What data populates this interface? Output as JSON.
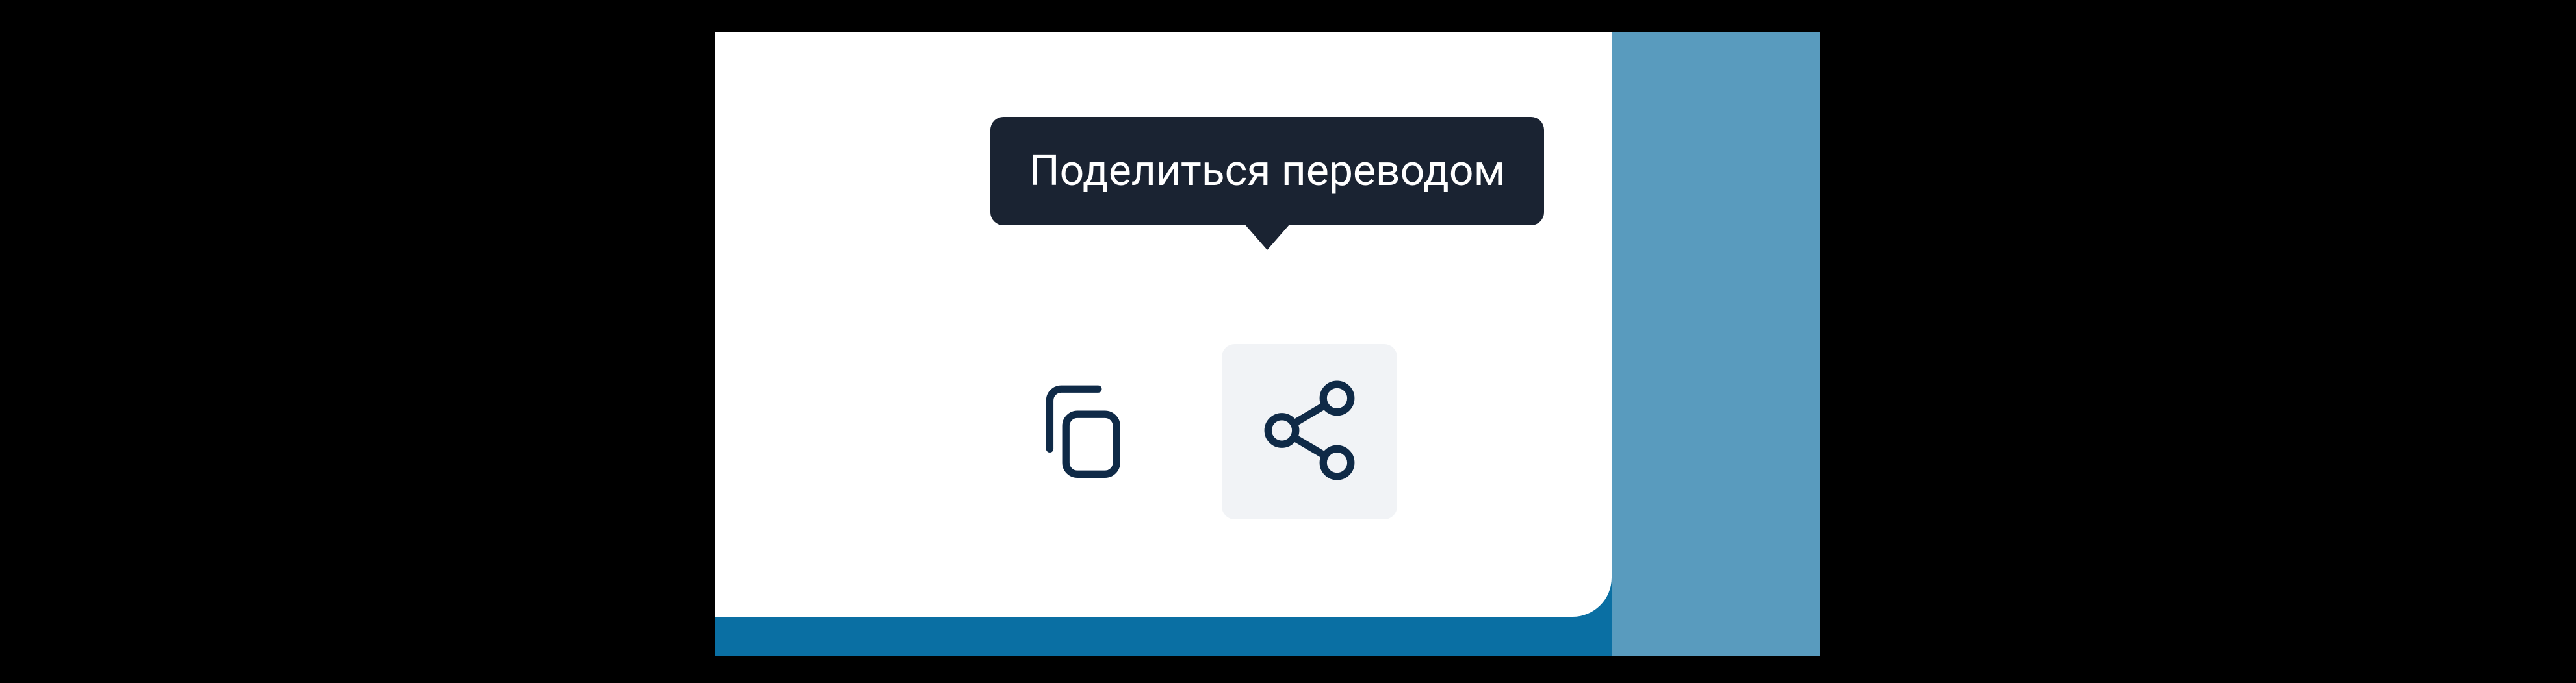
{
  "tooltip": {
    "share_label": "Поделиться переводом"
  },
  "icons": {
    "copy": "copy-icon",
    "share": "share-icon"
  }
}
